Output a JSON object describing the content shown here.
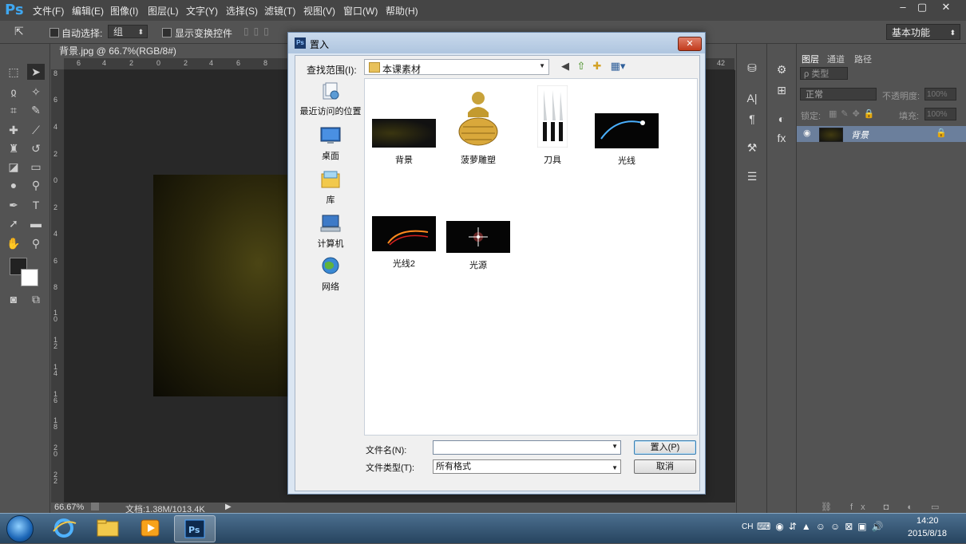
{
  "app": {
    "logo": "Ps",
    "menu": [
      "文件(F)",
      "编辑(E)",
      "图像(I)",
      "图层(L)",
      "文字(Y)",
      "选择(S)",
      "滤镜(T)",
      "视图(V)",
      "窗口(W)",
      "帮助(H)"
    ],
    "window_controls": [
      "–",
      "▢",
      "✕"
    ]
  },
  "options_bar": {
    "auto_select_label": "自动选择:",
    "auto_select_value": "组",
    "show_transform_label": "显示变换控件",
    "workspace": "基本功能"
  },
  "document": {
    "tab_title": "背景.jpg @ 66.7%(RGB/8#)",
    "tab_close": "×",
    "ruler_h_ticks": [
      "6",
      "4",
      "2",
      "0",
      "2",
      "4",
      "6",
      "8",
      "42"
    ],
    "ruler_v_ticks": [
      "8",
      "6",
      "4",
      "2",
      "0",
      "2",
      "4",
      "6",
      "8",
      "1 0",
      "1 2",
      "1 4",
      "1 6",
      "1 8",
      "2 0",
      "2 2"
    ],
    "zoom": "66.67%",
    "doc_size": "文档:1.38M/1013.4K"
  },
  "layers_panel": {
    "tabs": [
      "图层",
      "通道",
      "路径"
    ],
    "filter_kind": "ρ 类型",
    "blend_mode": "正常",
    "opacity_label": "不透明度:",
    "opacity_value": "100%",
    "lock_label": "锁定:",
    "fill_label": "填充:",
    "fill_value": "100%",
    "layers": [
      {
        "name": "背景"
      }
    ]
  },
  "dialog": {
    "title": "置入",
    "icon_text": "Ps",
    "look_in_label": "查找范围(I):",
    "look_in_value": "本课素材",
    "places": [
      {
        "label": "最近访问的位置",
        "icon": "recent-places-icon"
      },
      {
        "label": "桌面",
        "icon": "desktop-icon"
      },
      {
        "label": "库",
        "icon": "libraries-icon"
      },
      {
        "label": "计算机",
        "icon": "computer-icon"
      },
      {
        "label": "网络",
        "icon": "network-icon"
      }
    ],
    "files": [
      {
        "name": "背景",
        "thumb": "dark-texture"
      },
      {
        "name": "菠萝雕塑",
        "thumb": "pineapple-sculpture"
      },
      {
        "name": "刀具",
        "thumb": "knives"
      },
      {
        "name": "光线",
        "thumb": "light-streak"
      },
      {
        "name": "光线2",
        "thumb": "light-streak-2"
      },
      {
        "name": "光源",
        "thumb": "light-flare"
      }
    ],
    "filename_label": "文件名(N):",
    "filename_value": "",
    "filetype_label": "文件类型(T):",
    "filetype_value": "所有格式",
    "place_button": "置入(P)",
    "cancel_button": "取消"
  },
  "taskbar": {
    "lang": "CH",
    "time": "14:20",
    "date": "2015/8/18",
    "apps": [
      "internet-explorer",
      "file-explorer",
      "media-player",
      "photoshop"
    ]
  }
}
